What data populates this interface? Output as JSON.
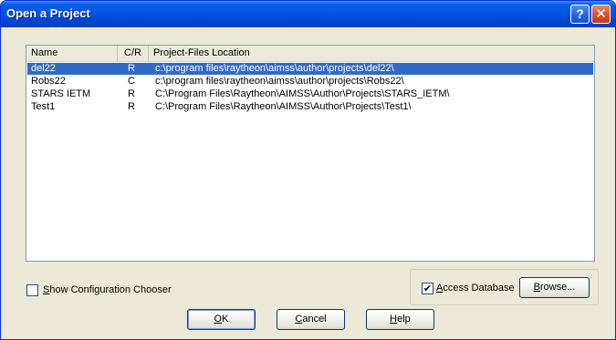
{
  "window": {
    "title": "Open a Project",
    "help_glyph": "?",
    "close_glyph": "✕"
  },
  "list": {
    "columns": [
      "Name",
      "C/R",
      "Project-Files Location"
    ],
    "rows": [
      {
        "name": "del22",
        "cr": "R",
        "location": "c:\\program files\\raytheon\\aimss\\author\\projects\\del22\\",
        "selected": true
      },
      {
        "name": "Robs22",
        "cr": "C",
        "location": "c:\\program files\\raytheon\\aimss\\author\\projects\\Robs22\\",
        "selected": false
      },
      {
        "name": "STARS IETM",
        "cr": "R",
        "location": "C:\\Program Files\\Raytheon\\AIMSS\\Author\\Projects\\STARS_IETM\\",
        "selected": false
      },
      {
        "name": "Test1",
        "cr": "R",
        "location": "C:\\Program Files\\Raytheon\\AIMSS\\Author\\Projects\\Test1\\",
        "selected": false
      }
    ]
  },
  "options": {
    "show_config": {
      "label": "Show Configuration Chooser",
      "mnemonic": "S",
      "rest": "how Configuration Chooser",
      "checked": false
    },
    "access_db": {
      "label": "Access Database",
      "mnemonic": "A",
      "rest": "ccess Database",
      "checked": true,
      "check_glyph": "✔"
    }
  },
  "buttons": {
    "browse": {
      "label": "Browse...",
      "mnemonic": "B",
      "rest": "rowse..."
    },
    "ok": {
      "label": "OK",
      "mnemonic": "O",
      "rest": "K"
    },
    "cancel": {
      "label": "Cancel",
      "mnemonic": "C",
      "rest": "ancel"
    },
    "help": {
      "label": "Help",
      "mnemonic": "H",
      "rest": "elp"
    }
  },
  "colors": {
    "titlebar": "#0055e5",
    "selection": "#316ac5",
    "dialog_bg": "#ece9d8"
  }
}
